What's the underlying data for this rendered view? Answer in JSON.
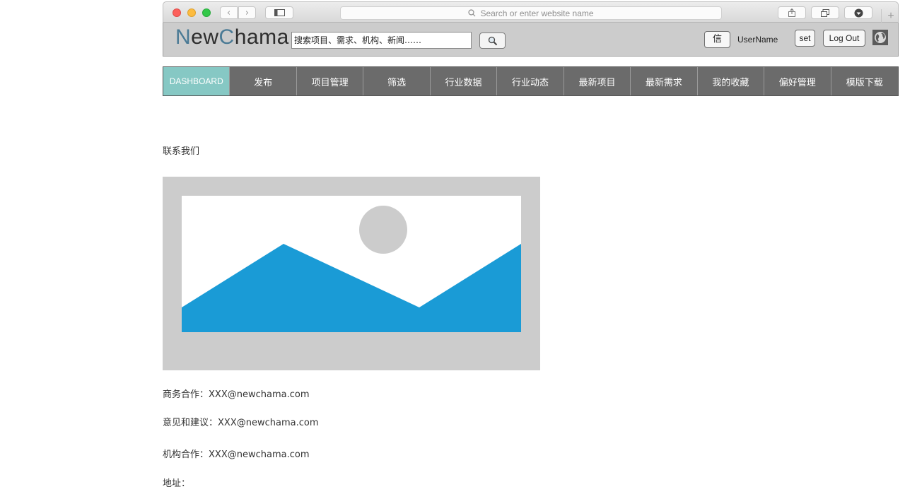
{
  "browser": {
    "url_placeholder": "Search or enter website name",
    "back_icon": "chevron-left-icon",
    "forward_icon": "chevron-right-icon",
    "new_tab_label": "+"
  },
  "header": {
    "logo_part1": "N",
    "logo_part2": "ew",
    "logo_part3": "C",
    "logo_part4": "hama",
    "search_value": "搜索项目、需求、机构、新闻……",
    "message_button": "信",
    "username": "UserName",
    "set_button": "set",
    "logout_button": "Log Out"
  },
  "nav": {
    "items": [
      {
        "label": "DASHBOARD",
        "active": true
      },
      {
        "label": "发布"
      },
      {
        "label": "项目管理"
      },
      {
        "label": "筛选"
      },
      {
        "label": "行业数据"
      },
      {
        "label": "行业动态"
      },
      {
        "label": "最新项目"
      },
      {
        "label": "最新需求"
      },
      {
        "label": "我的收藏"
      },
      {
        "label": "偏好管理"
      },
      {
        "label": "模版下载"
      }
    ]
  },
  "content": {
    "title": "联系我们",
    "contacts": [
      {
        "label": "商务合作：",
        "value": "XXX@newchama.com"
      },
      {
        "label": "意见和建议：",
        "value": "XXX@newchama.com"
      },
      {
        "label": "机构合作：",
        "value": "XXX@newchama.com"
      },
      {
        "label": "地址：",
        "value": ""
      }
    ]
  },
  "colors": {
    "accent_logo": "#4a7a95",
    "nav_active": "#86c8c4",
    "nav_bg": "#6b6b6b",
    "mountain": "#1a9bd6"
  }
}
